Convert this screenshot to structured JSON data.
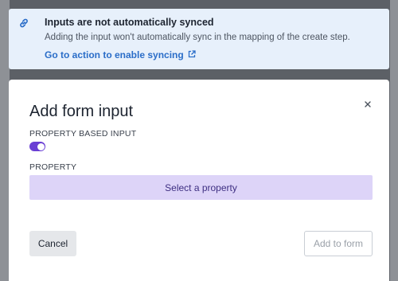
{
  "banner": {
    "title": "Inputs are not automatically synced",
    "description": "Adding the input won't automatically sync in the mapping of the create step.",
    "action_label": "Go to action to enable syncing",
    "accent_color": "#2a6dc8",
    "icon": "link-icon",
    "action_icon": "external-link-icon"
  },
  "modal": {
    "title": "Add form input",
    "close_icon": "close-icon",
    "property_based_label": "PROPERTY BASED INPUT",
    "property_based_enabled": true,
    "property_label": "PROPERTY",
    "property_placeholder": "Select a property",
    "cancel_label": "Cancel",
    "submit_label": "Add to form",
    "toggle_color": "#6a3fd4"
  }
}
